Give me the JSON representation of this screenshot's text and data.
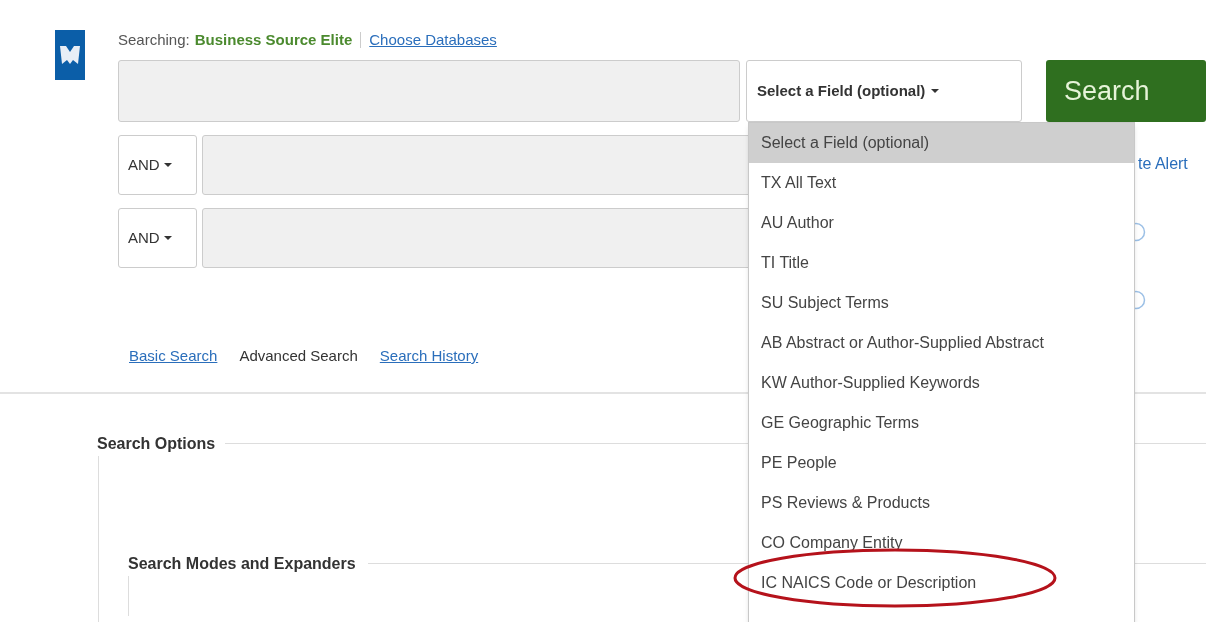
{
  "header": {
    "searching_label": "Searching:",
    "database": "Business Source Elite",
    "choose_link": "Choose Databases"
  },
  "search_rows": [
    {
      "operator": null,
      "field_select": "Select a Field (optional)"
    },
    {
      "operator": "AND"
    },
    {
      "operator": "AND"
    }
  ],
  "search_button": "Search",
  "side_links": [
    {
      "kind": "link",
      "text": "te Alert"
    },
    {
      "kind": "help"
    },
    {
      "kind": "help"
    }
  ],
  "field_menu": {
    "items": [
      {
        "label": "Select a Field (optional)",
        "selected": true,
        "circled": false
      },
      {
        "label": "TX All Text",
        "selected": false,
        "circled": false
      },
      {
        "label": "AU Author",
        "selected": false,
        "circled": false
      },
      {
        "label": "TI Title",
        "selected": false,
        "circled": false
      },
      {
        "label": "SU Subject Terms",
        "selected": false,
        "circled": false
      },
      {
        "label": "AB Abstract or Author-Supplied Abstract",
        "selected": false,
        "circled": false
      },
      {
        "label": "KW Author-Supplied Keywords",
        "selected": false,
        "circled": false
      },
      {
        "label": "GE Geographic Terms",
        "selected": false,
        "circled": false
      },
      {
        "label": "PE People",
        "selected": false,
        "circled": false
      },
      {
        "label": "PS Reviews & Products",
        "selected": false,
        "circled": false
      },
      {
        "label": "CO Company Entity",
        "selected": false,
        "circled": false
      },
      {
        "label": "IC NAICS Code or Description",
        "selected": false,
        "circled": true
      }
    ]
  },
  "nav_links": [
    {
      "label": "Basic Search",
      "selected": false
    },
    {
      "label": "Advanced Search",
      "selected": true
    },
    {
      "label": "Search History",
      "selected": false
    }
  ],
  "search_options": {
    "title": "Search Options",
    "sections": [
      {
        "title": "Search Modes and Expanders"
      }
    ]
  }
}
